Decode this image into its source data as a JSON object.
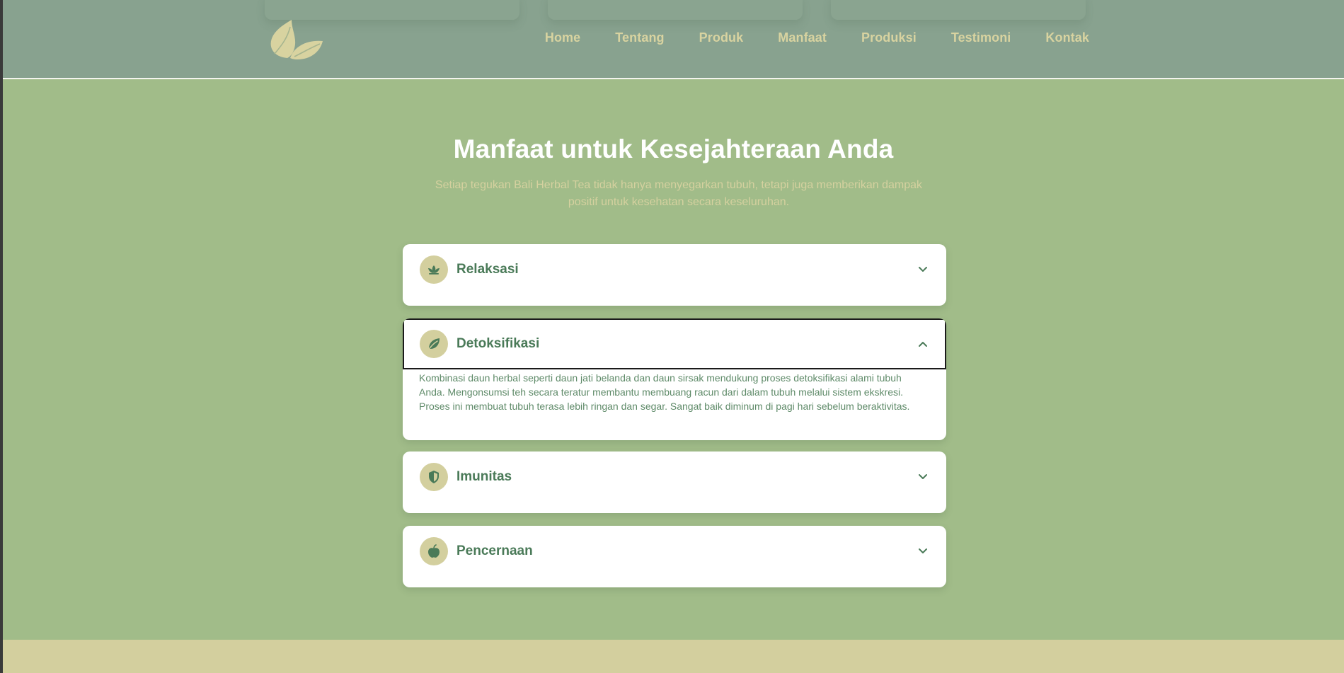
{
  "colors": {
    "page_bg": "#a1bc89",
    "header_bg": "#88a28f",
    "nav_text": "#d8d3a0",
    "accent_badge": "#d3cf9e",
    "heading_green": "#4a7a58",
    "footer": "#d3cf9e"
  },
  "header": {
    "logo_icon": "tea-leaves-icon",
    "nav": [
      "Home",
      "Tentang",
      "Produk",
      "Manfaat",
      "Produksi",
      "Testimoni",
      "Kontak"
    ]
  },
  "section": {
    "title": "Manfaat untuk Kesejahteraan Anda",
    "subtitle_line1": "Setiap tegukan Bali Herbal Tea tidak hanya menyegarkan tubuh, tetapi juga memberikan dampak",
    "subtitle_line2": "positif untuk kesehatan secara keseluruhan."
  },
  "benefits": [
    {
      "title": "Relaksasi",
      "icon": "lotus-icon",
      "expanded": false
    },
    {
      "title": "Detoksifikasi",
      "icon": "leaf-icon",
      "expanded": true,
      "body": "Kombinasi daun herbal seperti daun jati belanda dan daun sirsak mendukung proses detoksifikasi alami tubuh Anda. Mengonsumsi teh secara teratur membantu membuang racun dari dalam tubuh melalui sistem ekskresi. Proses ini membuat tubuh terasa lebih ringan dan segar. Sangat baik diminum di pagi hari sebelum beraktivitas."
    },
    {
      "title": "Imunitas",
      "icon": "shield-icon",
      "expanded": false
    },
    {
      "title": "Pencernaan",
      "icon": "apple-icon",
      "expanded": false
    }
  ]
}
